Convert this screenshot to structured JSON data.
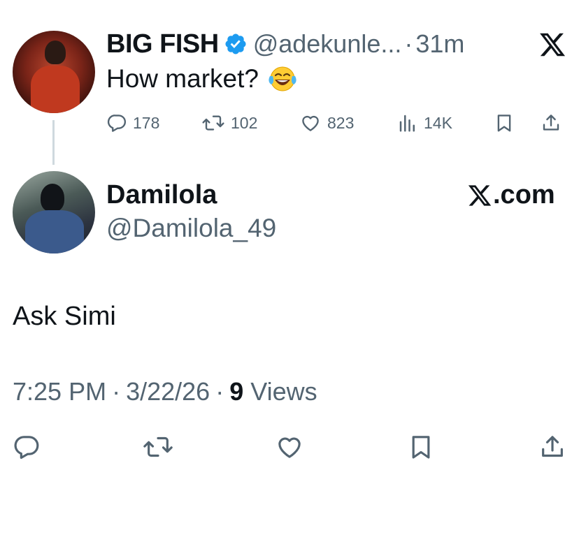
{
  "parent_tweet": {
    "display_name": "BIG FISH",
    "handle": "@adekunle...",
    "dot": "·",
    "time": "31m",
    "text": "How market?",
    "emoji": "face-with-tears-of-joy",
    "stats": {
      "replies": "178",
      "reposts": "102",
      "likes": "823",
      "views": "14K"
    }
  },
  "reply_tweet": {
    "display_name": "Damilola",
    "handle": "@Damilola_49",
    "text": "Ask Simi",
    "time": "7:25 PM",
    "dot1": "·",
    "date": "3/22/26",
    "dot2": "·",
    "views_count": "9",
    "views_label": "Views"
  },
  "branding": {
    "site_label": ".com"
  },
  "colors": {
    "text_primary": "#0f1419",
    "text_secondary": "#536471",
    "verified_blue": "#1d9bf0",
    "thread_line": "#cfd9de"
  },
  "icons": [
    "reply-icon",
    "repost-icon",
    "like-icon",
    "views-icon",
    "bookmark-icon",
    "share-icon",
    "x-logo-icon",
    "verified-badge-icon"
  ]
}
